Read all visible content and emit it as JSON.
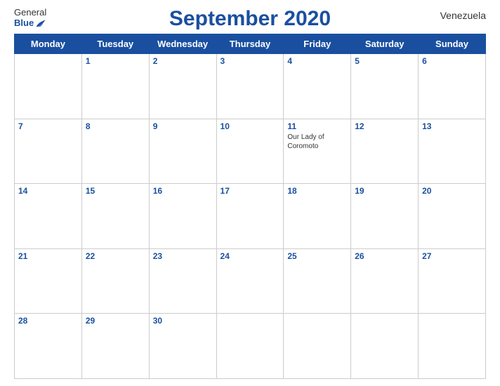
{
  "header": {
    "logo_general": "General",
    "logo_blue": "Blue",
    "title": "September 2020",
    "country": "Venezuela"
  },
  "weekdays": [
    "Monday",
    "Tuesday",
    "Wednesday",
    "Thursday",
    "Friday",
    "Saturday",
    "Sunday"
  ],
  "weeks": [
    [
      {
        "day": "",
        "holiday": ""
      },
      {
        "day": "1",
        "holiday": ""
      },
      {
        "day": "2",
        "holiday": ""
      },
      {
        "day": "3",
        "holiday": ""
      },
      {
        "day": "4",
        "holiday": ""
      },
      {
        "day": "5",
        "holiday": ""
      },
      {
        "day": "6",
        "holiday": ""
      }
    ],
    [
      {
        "day": "7",
        "holiday": ""
      },
      {
        "day": "8",
        "holiday": ""
      },
      {
        "day": "9",
        "holiday": ""
      },
      {
        "day": "10",
        "holiday": ""
      },
      {
        "day": "11",
        "holiday": "Our Lady of Coromoto"
      },
      {
        "day": "12",
        "holiday": ""
      },
      {
        "day": "13",
        "holiday": ""
      }
    ],
    [
      {
        "day": "14",
        "holiday": ""
      },
      {
        "day": "15",
        "holiday": ""
      },
      {
        "day": "16",
        "holiday": ""
      },
      {
        "day": "17",
        "holiday": ""
      },
      {
        "day": "18",
        "holiday": ""
      },
      {
        "day": "19",
        "holiday": ""
      },
      {
        "day": "20",
        "holiday": ""
      }
    ],
    [
      {
        "day": "21",
        "holiday": ""
      },
      {
        "day": "22",
        "holiday": ""
      },
      {
        "day": "23",
        "holiday": ""
      },
      {
        "day": "24",
        "holiday": ""
      },
      {
        "day": "25",
        "holiday": ""
      },
      {
        "day": "26",
        "holiday": ""
      },
      {
        "day": "27",
        "holiday": ""
      }
    ],
    [
      {
        "day": "28",
        "holiday": ""
      },
      {
        "day": "29",
        "holiday": ""
      },
      {
        "day": "30",
        "holiday": ""
      },
      {
        "day": "",
        "holiday": ""
      },
      {
        "day": "",
        "holiday": ""
      },
      {
        "day": "",
        "holiday": ""
      },
      {
        "day": "",
        "holiday": ""
      }
    ]
  ]
}
